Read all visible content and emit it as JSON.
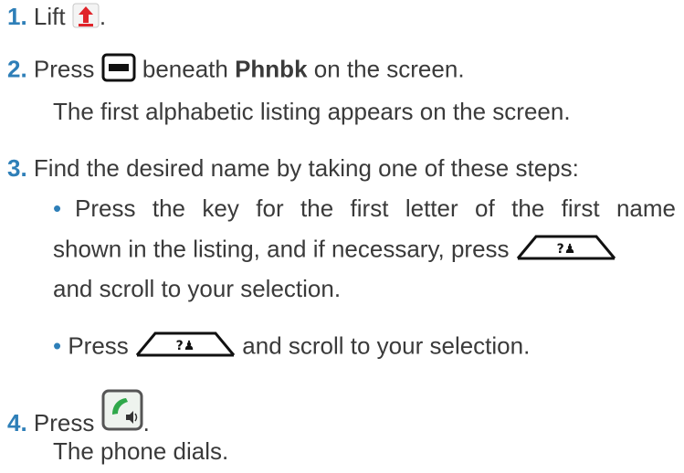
{
  "colors": {
    "step_number": "#2e7fb8",
    "text": "#3a3a3a",
    "lift_arrow": "#e0242a",
    "speaker_icon_green": "#2fa84a"
  },
  "steps": [
    {
      "number": "1.",
      "before": "Lift",
      "icon": "lift-handset-icon",
      "after": "."
    },
    {
      "number": "2.",
      "before": "Press",
      "icon": "softkey-button-icon",
      "bold": "Phnbk",
      "after": "on the screen.",
      "beneath": "beneath",
      "note": "The first alphabetic listing appears on the screen."
    },
    {
      "number": "3.",
      "text": "Find the desired name by taking one of these steps:",
      "bullets": [
        {
          "line1": "Press the key for the first letter of the first name",
          "line2_before": "shown in the listing, and if necessary, press",
          "line2_icon": "directory-softkey-icon",
          "line3": "and scroll to your selection."
        },
        {
          "before": "Press",
          "icon": "directory-softkey-icon",
          "after": "and scroll to your selection."
        }
      ]
    },
    {
      "number": "4.",
      "before": "Press",
      "icon": "speaker-phone-icon",
      "after": ".",
      "note": "The phone dials."
    }
  ],
  "bullet_char": "•",
  "directory_key_glyph": "?♟"
}
